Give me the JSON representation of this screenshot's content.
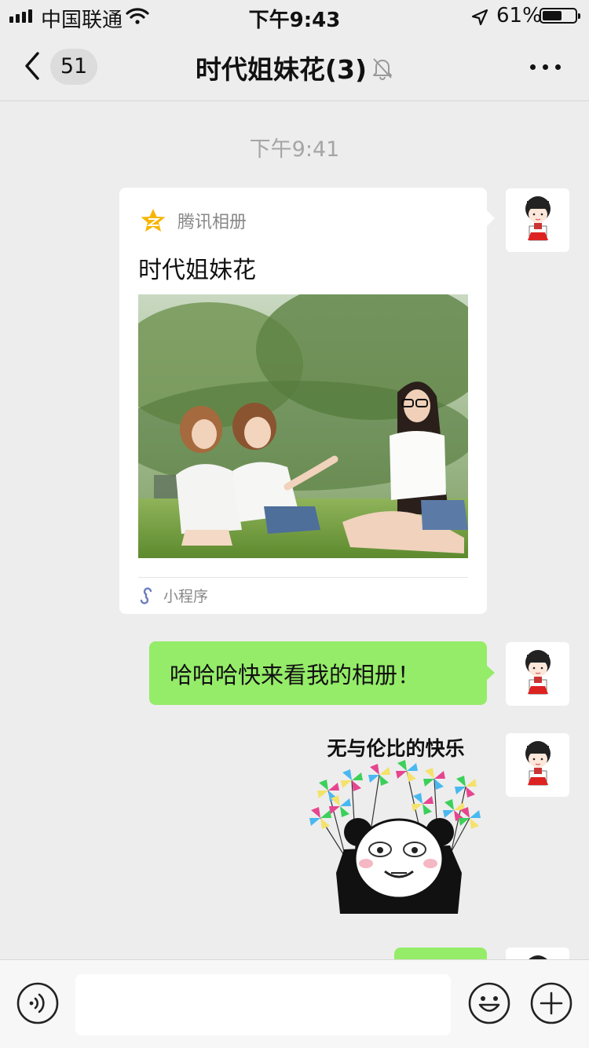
{
  "status_bar": {
    "carrier": "中国联通",
    "time": "下午9:43",
    "battery_percent": "61%",
    "battery_level": 0.61
  },
  "nav": {
    "back_icon": "chevron-left-icon",
    "unread_count": "51",
    "title": "时代姐妹花(3)",
    "mute_icon": "bell-off-icon",
    "more_icon": "more-dots-icon"
  },
  "chat": {
    "timestamp": "下午9:41",
    "messages": [
      {
        "type": "mini_program_card",
        "source": "腾讯相册",
        "title": "时代姐妹花",
        "footer": "小程序",
        "source_icon": "qzone-star-icon",
        "footer_icon": "mini-program-icon"
      },
      {
        "type": "text",
        "text": "哈哈哈快来看我的相册！"
      },
      {
        "type": "sticker",
        "caption": "无与伦比的快乐"
      }
    ]
  },
  "input_bar": {
    "voice_icon": "voice-icon",
    "emoji_icon": "emoji-icon",
    "plus_icon": "plus-icon",
    "input_value": ""
  },
  "colors": {
    "background": "#ededed",
    "bubble_green": "#95ec69",
    "timestamp_gray": "#a5a5a5"
  }
}
